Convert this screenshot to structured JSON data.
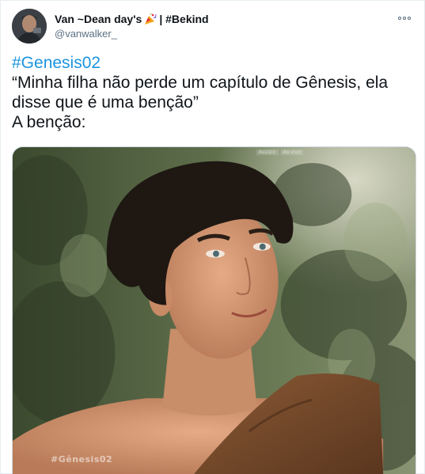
{
  "author": {
    "display_name": "Van ~Dean day's",
    "display_name_suffix": "| #Bekind",
    "handle": "@vanwalker_",
    "emoji_icon": "party-popper-icon"
  },
  "tweet": {
    "hashtag": "#Genesis02",
    "line1": "“Minha filha não perde um capítulo de Gênesis, ela",
    "line2": "disse que é uma benção”",
    "line3": "A benção:"
  },
  "media": {
    "watermark": "#Gênesis02",
    "player_items": [
      "Assistir",
      "Ao vivo"
    ],
    "colors": {
      "foliage_dark": "#2f3b26",
      "foliage_mid": "#5e6f48",
      "sky": "#c9cbb8",
      "skin": "#d99a78",
      "hair": "#1e1712",
      "cloth": "#7a4a2a"
    }
  },
  "colors": {
    "link": "#1b95e0",
    "secondary_text": "#5b7083",
    "border": "#e6ecf0"
  }
}
